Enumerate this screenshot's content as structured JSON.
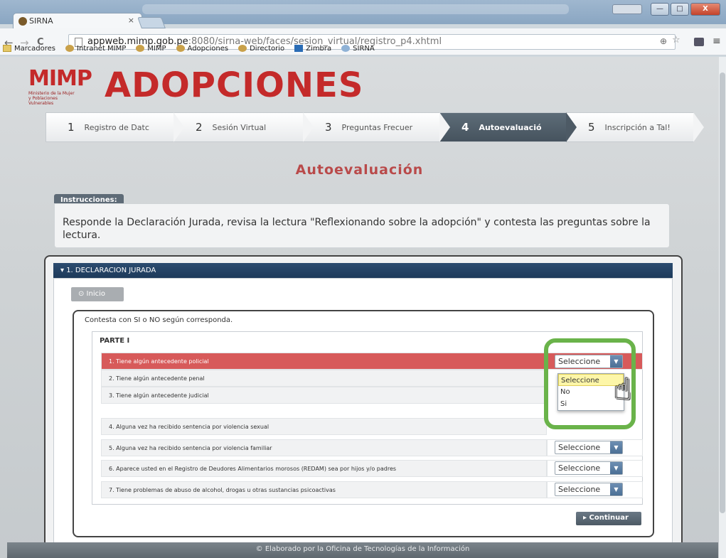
{
  "browser": {
    "tab_title": "SIRNA",
    "tab_close": "×",
    "window_buttons": [
      "—",
      "□",
      "X"
    ],
    "url_host": "appweb.mimp.gob.pe",
    "url_rest": ":8080/sirna-web/faces/sesion_virtual/registro_p4.xhtml",
    "nav_back": "←",
    "nav_forward": "→",
    "nav_reload": "C",
    "zoom_icon": "⊕",
    "star_icon": "☆",
    "menu_icon": "≡",
    "bookmarks": [
      "Marcadores",
      "Intranet MIMP",
      "MIMP",
      "Adopciones",
      "Directorio",
      "Zimbra",
      "SIRNA"
    ]
  },
  "header": {
    "logo": "MIMP",
    "logo_sub": "Ministerio de la Mujer y Poblaciones Vulnerables",
    "title": "ADOPCIONES"
  },
  "steps": [
    {
      "num": "1",
      "label": "Registro de Datc"
    },
    {
      "num": "2",
      "label": "Sesión Virtual"
    },
    {
      "num": "3",
      "label": "Preguntas Frecuer"
    },
    {
      "num": "4",
      "label": "Autoevaluació"
    },
    {
      "num": "5",
      "label": "Inscripción a Tal!"
    }
  ],
  "page_title": "Autoevaluación",
  "instructions": {
    "tag": "Instrucciones:",
    "text": "Responde la Declaración Jurada, revisa la lectura \"Reflexionando sobre la adopción\" y contesta las preguntas sobre la lectura."
  },
  "section": {
    "title": "▾ 1. DECLARACION JURADA",
    "inicio": "⊙ Inicio",
    "hint": "Contesta con SI o NO según corresponda.",
    "part": "PARTE I",
    "questions": [
      "1. Tiene algún antecedente policial",
      "2. Tiene algún antecedente penal",
      "3. Tiene algún antecedente judicial",
      "4. Alguna vez ha recibido sentencia por violencia sexual",
      "5. Alguna vez ha recibido sentencia por violencia familiar",
      "6. Aparece usted en el Registro de Deudores Alimentarios morosos (REDAM) sea por hijos y/o padres",
      "7. Tiene problemas de abuso de alcohol, drogas u otras sustancias psicoactivas"
    ],
    "select_value": "Seleccione",
    "dropdown_options": [
      "Seleccione",
      "No",
      "Si"
    ],
    "continue": "Continuar"
  },
  "footer": "© Elaborado por la Oficina de Tecnologías de la Información"
}
